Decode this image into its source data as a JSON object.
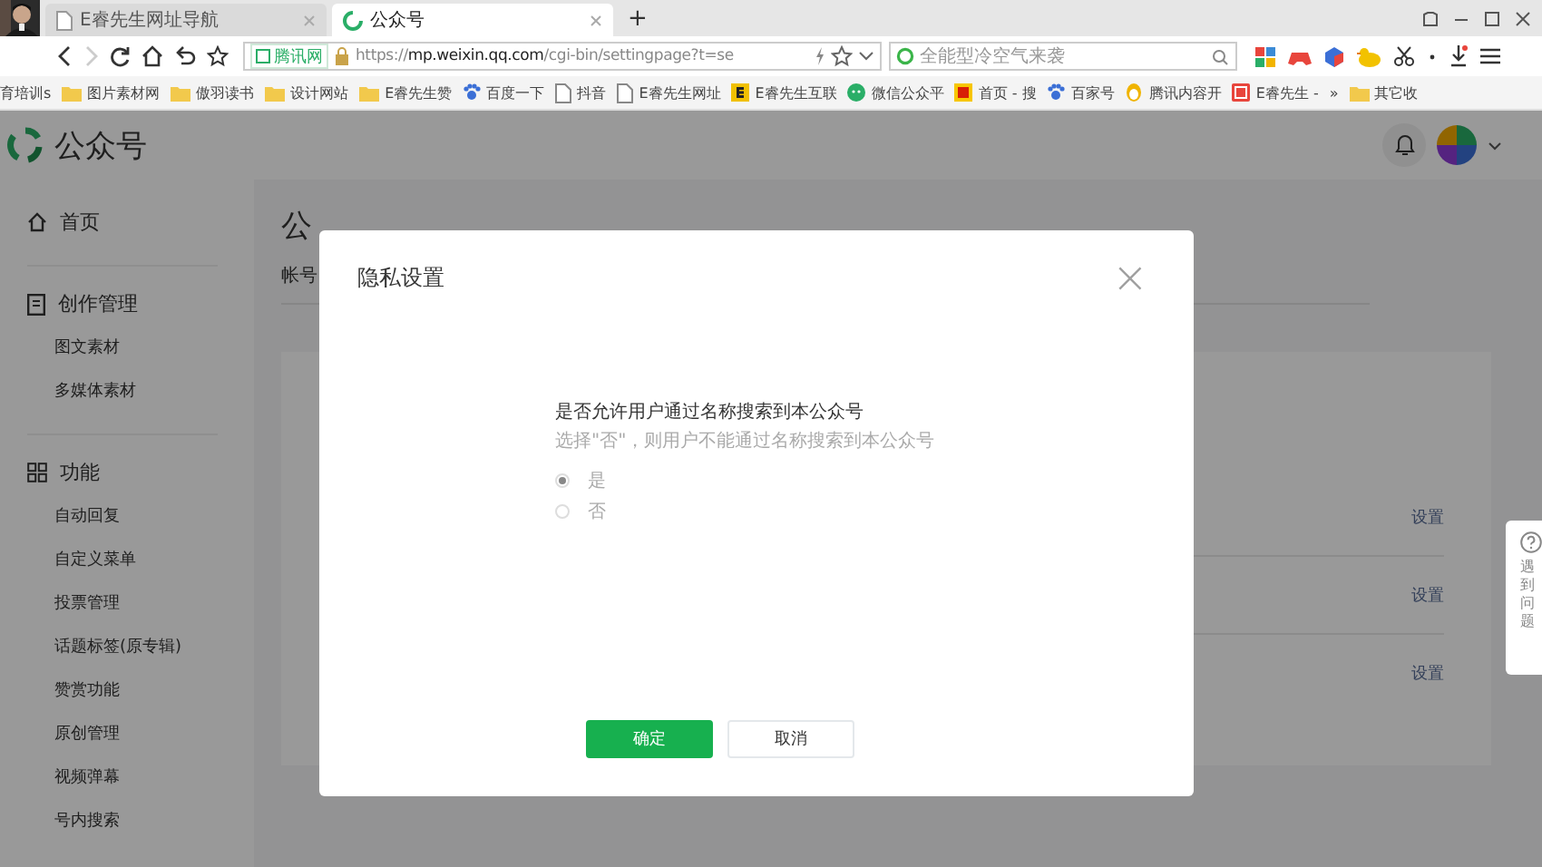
{
  "browser": {
    "tabs": [
      {
        "label": "E睿先生网址导航",
        "selected": false
      },
      {
        "label": "公众号",
        "selected": true
      }
    ],
    "new_tab": "+",
    "address": {
      "badge": "腾讯网",
      "url": "https://mp.weixin.qq.com/cgi-bin/settingpage?t=se"
    },
    "search": {
      "placeholder": "全能型冷空气来袭"
    },
    "bookmarks": [
      {
        "label": "育培训s",
        "kind": "plain"
      },
      {
        "label": "图片素材网",
        "kind": "folder"
      },
      {
        "label": "傲羽读书",
        "kind": "folder"
      },
      {
        "label": "设计网站",
        "kind": "folder"
      },
      {
        "label": "E睿先生赞",
        "kind": "folder"
      },
      {
        "label": "百度一下",
        "kind": "paw"
      },
      {
        "label": "抖音",
        "kind": "page"
      },
      {
        "label": "E睿先生网址",
        "kind": "page"
      },
      {
        "label": "E睿先生互联",
        "kind": "letter"
      },
      {
        "label": "微信公众平",
        "kind": "chat"
      },
      {
        "label": "首页 - 搜",
        "kind": "badge"
      },
      {
        "label": "百家号",
        "kind": "paw"
      },
      {
        "label": "腾讯内容开",
        "kind": "penguin"
      },
      {
        "label": "E睿先生 -",
        "kind": "square"
      },
      {
        "label": "»",
        "kind": "plain"
      },
      {
        "label": "其它收",
        "kind": "folder"
      }
    ]
  },
  "app": {
    "logo": "公众号",
    "sidebar": [
      {
        "label": "首页",
        "kind": "home"
      },
      {
        "label": "创作管理",
        "kind": "document",
        "children": [
          "图文素材",
          "多媒体素材"
        ]
      },
      {
        "label": "功能",
        "kind": "grid",
        "children": [
          "自动回复",
          "自定义菜单",
          "投票管理",
          "话题标签(原专辑)",
          "赞赏功能",
          "原创管理",
          "视频弹幕",
          "号内搜索"
        ]
      }
    ],
    "page_title": "公",
    "tab": "帐号",
    "rows": [
      "设置",
      "设置",
      "设置"
    ],
    "help": "遇到问题"
  },
  "dialog": {
    "title": "隐私设置",
    "close": "×",
    "question": "是否允许用户通过名称搜索到本公众号",
    "hint": "选择\"否\"，则用户不能通过名称搜索到本公众号",
    "options": [
      {
        "label": "是",
        "selected": true
      },
      {
        "label": "否",
        "selected": false
      }
    ],
    "buttons": [
      {
        "label": "确定",
        "kind": "primary"
      },
      {
        "label": "取消",
        "kind": "default"
      }
    ]
  }
}
